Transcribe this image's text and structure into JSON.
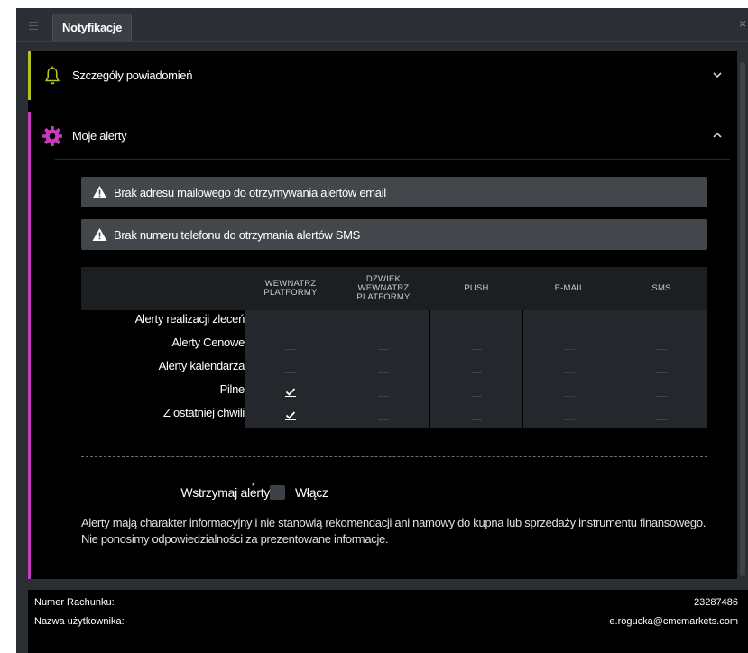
{
  "window": {
    "tab_label": "Notyfikacje",
    "close_glyph": "×"
  },
  "sections": {
    "details": {
      "title": "Szczegóły powiadomień",
      "icon": "bell-icon",
      "accent": "#b6c21d",
      "expanded": false
    },
    "alerts": {
      "title": "Moje alerty",
      "icon": "gear-icon",
      "accent": "#c53cbf",
      "expanded": true
    }
  },
  "warnings": [
    {
      "text": "Brak adresu mailowego do otrzymywania alertów email"
    },
    {
      "text": "Brak numeru telefonu do otrzymania alertów SMS"
    }
  ],
  "table": {
    "columns": [
      {
        "label": "WEWNATRZ PLATFORMY"
      },
      {
        "label": "DZWIEK WEWNATRZ PLATFORMY"
      },
      {
        "label": "PUSH"
      },
      {
        "label": "E-MAIL"
      },
      {
        "label": "SMS"
      }
    ],
    "rows": [
      {
        "label": "Alerty realizacji zleceń",
        "checked": [
          false,
          false,
          false,
          false,
          false
        ]
      },
      {
        "label": "Alerty Cenowe",
        "checked": [
          false,
          false,
          false,
          false,
          false
        ]
      },
      {
        "label": "Alerty kalendarza",
        "checked": [
          false,
          false,
          false,
          false,
          false
        ]
      },
      {
        "label": "Pilne",
        "checked": [
          true,
          false,
          false,
          false,
          false
        ]
      },
      {
        "label": "Z ostatniej chwili",
        "checked": [
          true,
          false,
          false,
          false,
          false
        ]
      }
    ]
  },
  "suspend": {
    "label": "Wstrzymaj alerty",
    "asterisk": "*",
    "toggle_label": "Włącz",
    "checked": false
  },
  "disclaimer": "Alerty mają charakter informacyjny i nie stanowią rekomendacji ani namowy do kupna lub sprzedaży instrumentu finansowego. Nie ponosimy odpowiedzialności za prezentowane informacje.",
  "footer": {
    "account_label": "Numer Rachunku:",
    "account_value": "23287486",
    "user_label": "Nazwa użytkownika:",
    "user_value": "e.rogucka@cmcmarkets.com"
  },
  "colors": {
    "window_bg": "#2a2d31",
    "content_bg": "#000000",
    "warning_bg": "#43474c",
    "bell_accent": "#b6c21d",
    "gear_accent": "#c53cbf"
  }
}
